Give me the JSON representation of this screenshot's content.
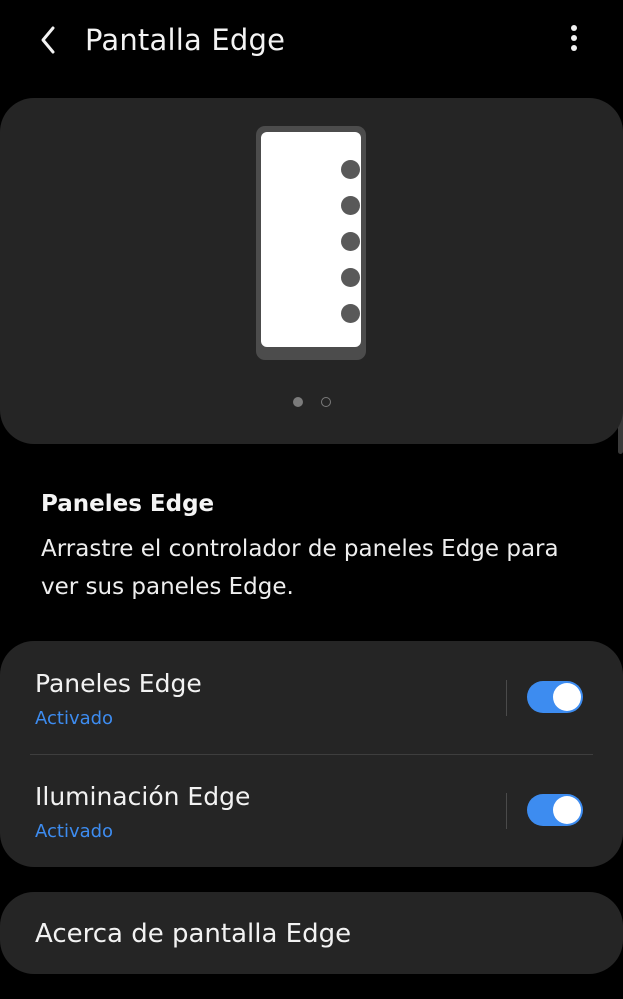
{
  "header": {
    "title": "Pantalla Edge",
    "back_icon": "chevron-left-icon",
    "more_icon": "more-vertical-icon"
  },
  "preview": {
    "handle_count": 5,
    "pager": {
      "total": 2,
      "current": 1
    }
  },
  "description": {
    "title": "Paneles Edge",
    "body": "Arrastre el controlador de paneles Edge para ver sus paneles Edge."
  },
  "settings": [
    {
      "label": "Paneles Edge",
      "status": "Activado",
      "enabled": true
    },
    {
      "label": "Iluminación Edge",
      "status": "Activado",
      "enabled": true
    }
  ],
  "about": {
    "label": "Acerca de pantalla Edge"
  },
  "colors": {
    "background": "#000000",
    "card": "#252525",
    "accent": "#3d8cf0",
    "text": "#f2f2f2"
  }
}
